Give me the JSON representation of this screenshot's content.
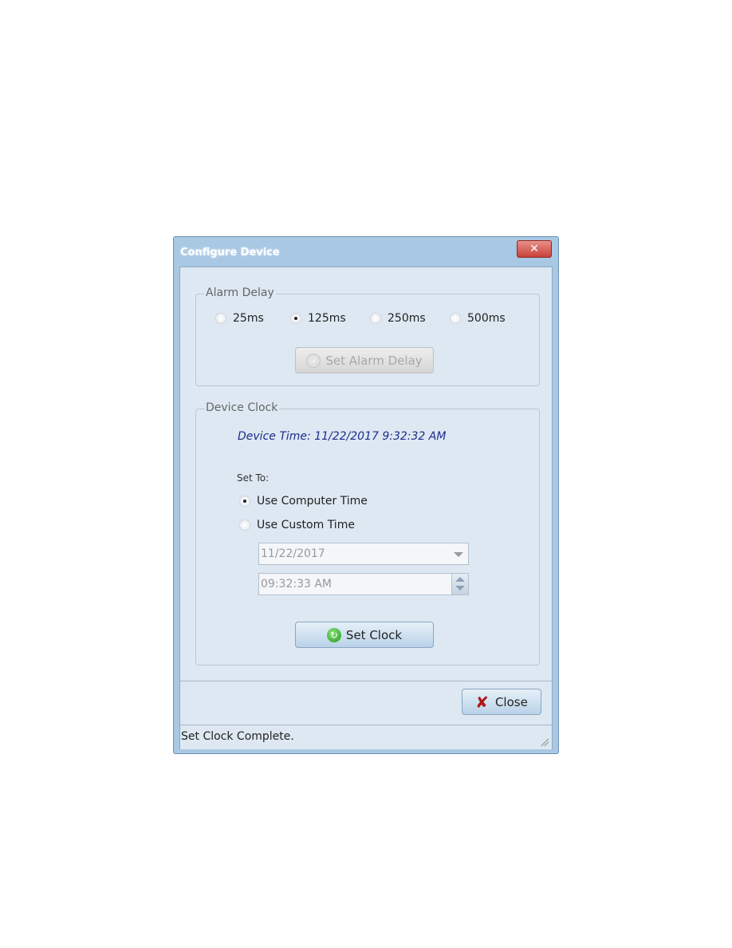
{
  "window": {
    "title": "Configure Device",
    "close_glyph": "✕"
  },
  "alarm_delay": {
    "label": "Alarm Delay",
    "options": [
      {
        "label": "25ms",
        "selected": false
      },
      {
        "label": "125ms",
        "selected": true
      },
      {
        "label": "250ms",
        "selected": false
      },
      {
        "label": "500ms",
        "selected": false
      }
    ],
    "button_label": "Set Alarm Delay",
    "button_enabled": false
  },
  "device_clock": {
    "label": "Device Clock",
    "device_time": "Device Time: 11/22/2017 9:32:32 AM",
    "set_to_label": "Set To:",
    "options": [
      {
        "label": "Use Computer Time",
        "selected": true
      },
      {
        "label": "Use Custom Time",
        "selected": false
      }
    ],
    "date_value": "11/22/2017",
    "time_value": "09:32:33 AM",
    "button_label": "Set Clock"
  },
  "footer": {
    "close_label": "Close"
  },
  "status": {
    "text": "Set Clock Complete."
  },
  "icons": {
    "refresh": "refresh-icon",
    "close": "close-x-icon"
  }
}
